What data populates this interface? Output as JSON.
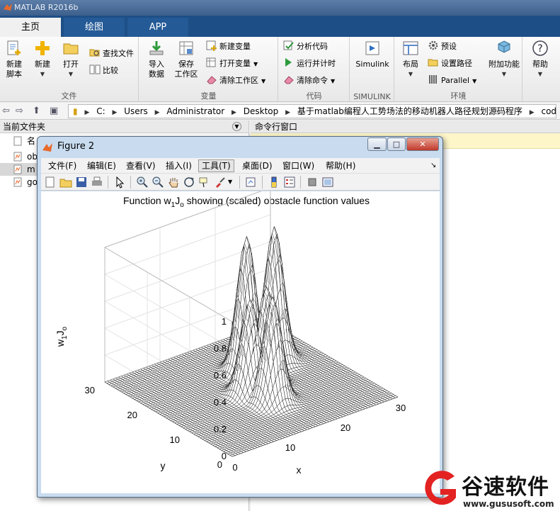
{
  "app": {
    "title": "MATLAB R2016b"
  },
  "ribbon_tabs": [
    {
      "label": "主页",
      "active": true
    },
    {
      "label": "绘图",
      "active": false
    },
    {
      "label": "APP",
      "active": false
    }
  ],
  "ribbon": {
    "groups": {
      "file": "文件",
      "variable": "变量",
      "code": "代码",
      "simulink": "SIMULINK",
      "env": "环境"
    },
    "new_script": [
      "新建",
      "脚本"
    ],
    "new": "新建",
    "open": "打开",
    "find_files": "查找文件",
    "compare": "比较",
    "import": [
      "导入",
      "数据"
    ],
    "save_ws": [
      "保存",
      "工作区"
    ],
    "new_var": "新建变量",
    "open_var": "打开变量",
    "clear_ws": "清除工作区",
    "analyze": "分析代码",
    "run_time": "运行并计时",
    "clear_cmd": "清除命令",
    "simulink": "Simulink",
    "layout": "布局",
    "prefs": "预设",
    "set_path": "设置路径",
    "parallel": "Parallel",
    "addons": "附加功能",
    "help": "帮助"
  },
  "address": {
    "segments": [
      "C:",
      "Users",
      "Administrator",
      "Desktop",
      "基于matlab编程人工势场法的移动机器人路径规划源码程序",
      "code"
    ]
  },
  "current_folder": {
    "title": "当前文件夹",
    "column": "名",
    "files": [
      {
        "name": "ob",
        "selected": false
      },
      {
        "name": "m",
        "selected": true
      },
      {
        "name": "go",
        "selected": false
      }
    ]
  },
  "command_window": {
    "title": "命令行窗口"
  },
  "figure": {
    "title": "Figure 2",
    "menus": [
      "文件(F)",
      "编辑(E)",
      "查看(V)",
      "插入(I)",
      "工具(T)",
      "桌面(D)",
      "窗口(W)",
      "帮助(H)"
    ],
    "selected_menu": "工具(T)"
  },
  "chart_data": {
    "type": "surface",
    "title": "Function w₁J₀ showing (scaled) obstacle function values",
    "title_main": "Function w",
    "title_sub1": "1",
    "title_mid": "J",
    "title_sub2": "o",
    "title_rest": " showing (scaled) obstacle function values",
    "zlabel_main": "w",
    "zlabel_sub1": "1",
    "zlabel_mid": "J",
    "zlabel_sub2": "o",
    "xlabel": "x",
    "ylabel": "y",
    "xlim": [
      0,
      30
    ],
    "ylim": [
      0,
      30
    ],
    "zlim": [
      0,
      1
    ],
    "xticks": [
      "0",
      "10",
      "20",
      "30"
    ],
    "yticks": [
      "0",
      "10",
      "20",
      "30"
    ],
    "zticks": [
      "0",
      "0.2",
      "0.4",
      "0.6",
      "0.8",
      "1"
    ],
    "grid": true,
    "peaks": [
      {
        "x": 15,
        "y": 10,
        "height": 0.78
      },
      {
        "x": 14,
        "y": 14,
        "height": 0.7
      },
      {
        "x": 17,
        "y": 14,
        "height": 0.75
      },
      {
        "x": 18,
        "y": 20,
        "height": 1.0
      },
      {
        "x": 23,
        "y": 20,
        "height": 1.0
      }
    ],
    "peak_width": 1.4
  },
  "watermark": {
    "brand": "谷速软件",
    "url": "www.gususoft.com"
  }
}
